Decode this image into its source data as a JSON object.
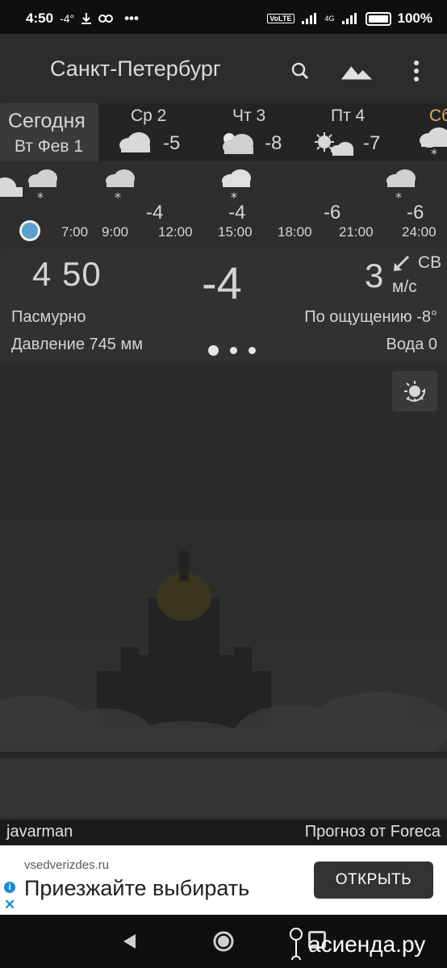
{
  "status_bar": {
    "time": "4:50",
    "temp_badge": "-4°",
    "dots": "•••",
    "volte": "VoLTE",
    "network": "4G",
    "battery": "100%"
  },
  "header": {
    "city": "Санкт-Петербург",
    "search_icon": "search-icon",
    "landscape_icon": "landscape-icon",
    "menu_icon": "more-vert-icon"
  },
  "days": [
    {
      "label": "Сегодня",
      "date": "Вт Фев 1",
      "today": true
    },
    {
      "label": "Ср 2",
      "temp": "-5",
      "icon": "cloud-icon"
    },
    {
      "label": "Чт 3",
      "temp": "-8",
      "icon": "partly-cloudy-icon"
    },
    {
      "label": "Пт 4",
      "temp": "-7",
      "icon": "sun-cloud-icon"
    },
    {
      "label": "Сб",
      "icon": "snow-cloud-icon"
    }
  ],
  "hourly": {
    "times": [
      "7:00",
      "9:00",
      "12:00",
      "15:00",
      "18:00",
      "21:00",
      "24:00"
    ],
    "temps": [
      "-4",
      "-4",
      "-6",
      "-6"
    ]
  },
  "current": {
    "time": "4  50",
    "temp": "-4",
    "wind_speed": "3",
    "wind_dir": "СВ",
    "wind_unit": "м/с",
    "condition": "Пасмурно",
    "feels_like": "По ощущению -8°",
    "pressure": "Давление 745 мм",
    "water": "Вода 0"
  },
  "credits": {
    "author": "javarman",
    "forecast": "Прогноз от Foreca"
  },
  "ad": {
    "domain": "vsedverizdes.ru",
    "headline": "Приезжайте выбирать",
    "button": "ОТКРЫТЬ"
  },
  "watermark": "асиенда.ру"
}
